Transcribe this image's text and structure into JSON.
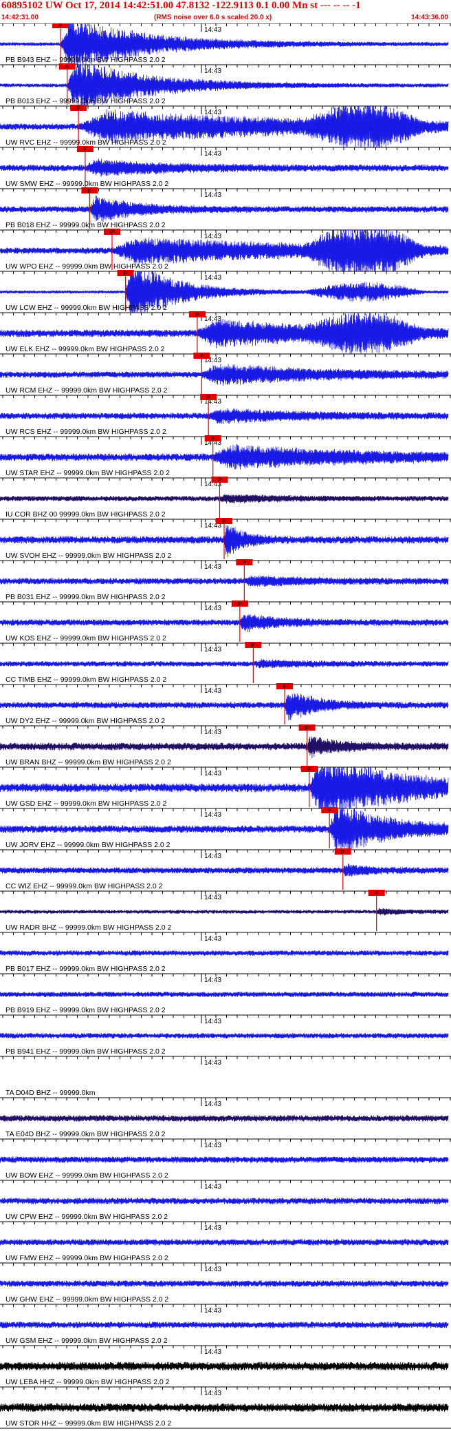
{
  "header": {
    "title": "60895102 UW Oct 17, 2014 14:42:51.00   47.8132 -122.9113  0.1 0.00 Mn st --- -- --  -1",
    "start_time": "14:42:31.00",
    "note": "(RMS noise over 6.0 s scaled 20.0 x)",
    "end_time": "14:43:36.00"
  },
  "minute_label": "14:43",
  "pick_label": "P",
  "colors": {
    "trace": "#1a1ae6",
    "trace_dark": "#221066",
    "trace_black": "#000000",
    "pick": "#e00000",
    "text": "#000000",
    "grid": "#000000"
  },
  "traces": [
    {
      "label": "PB B943 EHZ -- 99999.0km BW  HIGHPASS  2.0  2",
      "pick_frac": 0.135,
      "event_amp": 1.0,
      "event_len": 0.28,
      "noise": 0.07,
      "color": "trace"
    },
    {
      "label": "PB B013 EHZ -- 99999.0km BW  HIGHPASS  2.0  2",
      "pick_frac": 0.15,
      "event_amp": 1.0,
      "event_len": 0.26,
      "noise": 0.07,
      "color": "trace"
    },
    {
      "label": "UW RVC EHZ -- 99999.0km BW  HIGHPASS  2.0  2",
      "pick_frac": 0.175,
      "event_amp": 0.55,
      "event_len": 0.8,
      "noise": 0.12,
      "color": "trace",
      "late_burst": 0.8
    },
    {
      "label": "UW SMW EHZ -- 99999.0km BW  HIGHPASS  2.0  2",
      "pick_frac": 0.19,
      "event_amp": 0.25,
      "event_len": 0.3,
      "noise": 0.12,
      "color": "trace"
    },
    {
      "label": "PB B018 EHZ -- 99999.0km BW  HIGHPASS  2.0  2",
      "pick_frac": 0.2,
      "event_amp": 0.45,
      "event_len": 0.15,
      "noise": 0.12,
      "color": "trace"
    },
    {
      "label": "UW WPO EHZ -- 99999.0km BW  HIGHPASS  2.0  2",
      "pick_frac": 0.25,
      "event_amp": 0.45,
      "event_len": 0.7,
      "noise": 0.12,
      "color": "trace",
      "late_burst": 1.0
    },
    {
      "label": "UW LCW EHZ -- 99999.0km BW  HIGHPASS  2.0  2",
      "pick_frac": 0.28,
      "event_amp": 1.2,
      "event_len": 0.16,
      "noise": 0.06,
      "color": "trace",
      "late_burst": 0.35
    },
    {
      "label": "UW ELK EHZ -- 99999.0km BW  HIGHPASS  2.0  2",
      "pick_frac": 0.44,
      "event_amp": 0.45,
      "event_len": 0.5,
      "noise": 0.14,
      "color": "trace",
      "late_burst": 0.65
    },
    {
      "label": "UW RCM EHZ -- 99999.0km BW  HIGHPASS  2.0  2",
      "pick_frac": 0.45,
      "event_amp": 0.35,
      "event_len": 0.4,
      "noise": 0.12,
      "color": "trace"
    },
    {
      "label": "UW RCS EHZ -- 99999.0km BW  HIGHPASS  2.0  2",
      "pick_frac": 0.465,
      "event_amp": 0.22,
      "event_len": 0.3,
      "noise": 0.12,
      "color": "trace"
    },
    {
      "label": "UW STAR EHZ -- 99999.0km BW  HIGHPASS  2.0  2",
      "pick_frac": 0.475,
      "event_amp": 0.4,
      "event_len": 0.5,
      "noise": 0.14,
      "color": "trace"
    },
    {
      "label": "IU COR BHZ 00 99999.0km BW  HIGHPASS  2.0  2",
      "pick_frac": 0.49,
      "event_amp": 0.12,
      "event_len": 0.2,
      "noise": 0.1,
      "color": "trace_dark"
    },
    {
      "label": "UW SVOH EHZ -- 99999.0km BW  HIGHPASS  2.0  2",
      "pick_frac": 0.5,
      "event_amp": 0.6,
      "event_len": 0.06,
      "noise": 0.14,
      "color": "trace"
    },
    {
      "label": "PB B031 EHZ -- 99999.0km BW  HIGHPASS  2.0  2",
      "pick_frac": 0.545,
      "event_amp": 0.15,
      "event_len": 0.2,
      "noise": 0.12,
      "color": "trace"
    },
    {
      "label": "UW KOS EHZ -- 99999.0km BW  HIGHPASS  2.0  2",
      "pick_frac": 0.535,
      "event_amp": 0.3,
      "event_len": 0.12,
      "noise": 0.12,
      "color": "trace"
    },
    {
      "label": "CC TIMB EHZ -- 99999.0km BW  HIGHPASS  2.0  2",
      "pick_frac": 0.565,
      "event_amp": 0.1,
      "event_len": 0.2,
      "noise": 0.1,
      "color": "trace"
    },
    {
      "label": "UW DY2 EHZ -- 99999.0km BW  HIGHPASS  2.0  2",
      "pick_frac": 0.635,
      "event_amp": 0.55,
      "event_len": 0.1,
      "noise": 0.12,
      "color": "trace"
    },
    {
      "label": "UW BRAN BHZ -- 99999.0km BW  HIGHPASS  2.0  2",
      "pick_frac": 0.685,
      "event_amp": 0.35,
      "event_len": 0.1,
      "noise": 0.14,
      "color": "trace_dark"
    },
    {
      "label": "UW GSD EHZ -- 99999.0km BW  HIGHPASS  2.0  2",
      "pick_frac": 0.69,
      "event_amp": 1.1,
      "event_len": 0.32,
      "noise": 0.16,
      "color": "trace"
    },
    {
      "label": "UW JORV EHZ -- 99999.0km BW  HIGHPASS  2.0  2",
      "pick_frac": 0.735,
      "event_amp": 0.9,
      "event_len": 0.2,
      "noise": 0.14,
      "color": "trace"
    },
    {
      "label": "CC WIZ EHZ -- 99999.0km BW  HIGHPASS  2.0  2",
      "pick_frac": 0.765,
      "event_amp": 0.2,
      "event_len": 0.08,
      "noise": 0.12,
      "color": "trace"
    },
    {
      "label": "UW RADR BHZ -- 99999.0km BW  HIGHPASS  2.0  2",
      "pick_frac": 0.84,
      "event_amp": 0.1,
      "event_len": 0.1,
      "noise": 0.07,
      "color": "trace_dark"
    },
    {
      "label": "PB B017 EHZ -- 99999.0km BW  HIGHPASS  2.0  2",
      "noise": 0.1,
      "color": "trace"
    },
    {
      "label": "PB B919 EHZ -- 99999.0km BW  HIGHPASS  2.0  2",
      "noise": 0.1,
      "color": "trace"
    },
    {
      "label": "PB B941 EHZ -- 99999.0km BW  HIGHPASS  2.0  2",
      "noise": 0.1,
      "color": "trace"
    },
    {
      "label": "TA D04D BHZ -- 99999.0km",
      "noise": 0.0,
      "color": "trace"
    },
    {
      "label": "TA E04D BHZ -- 99999.0km BW  HIGHPASS  2.0  2",
      "noise": 0.12,
      "color": "trace_dark"
    },
    {
      "label": "UW BOW EHZ -- 99999.0km BW  HIGHPASS  2.0  2",
      "noise": 0.12,
      "color": "trace"
    },
    {
      "label": "UW CPW EHZ -- 99999.0km BW  HIGHPASS  2.0  2",
      "noise": 0.12,
      "color": "trace"
    },
    {
      "label": "UW FMW EHZ -- 99999.0km BW  HIGHPASS  2.0  2",
      "noise": 0.12,
      "color": "trace"
    },
    {
      "label": "UW GHW EHZ -- 99999.0km BW  HIGHPASS  2.0  2",
      "noise": 0.12,
      "color": "trace"
    },
    {
      "label": "UW GSM EHZ -- 99999.0km BW  HIGHPASS  2.0  2",
      "noise": 0.12,
      "color": "trace"
    },
    {
      "label": "UW LEBA HHZ -- 99999.0km BW  HIGHPASS  2.0  2",
      "noise": 0.16,
      "color": "trace_black"
    },
    {
      "label": "UW STOR HHZ -- 99999.0km BW  HIGHPASS  2.0  2",
      "noise": 0.16,
      "color": "trace_black"
    }
  ]
}
